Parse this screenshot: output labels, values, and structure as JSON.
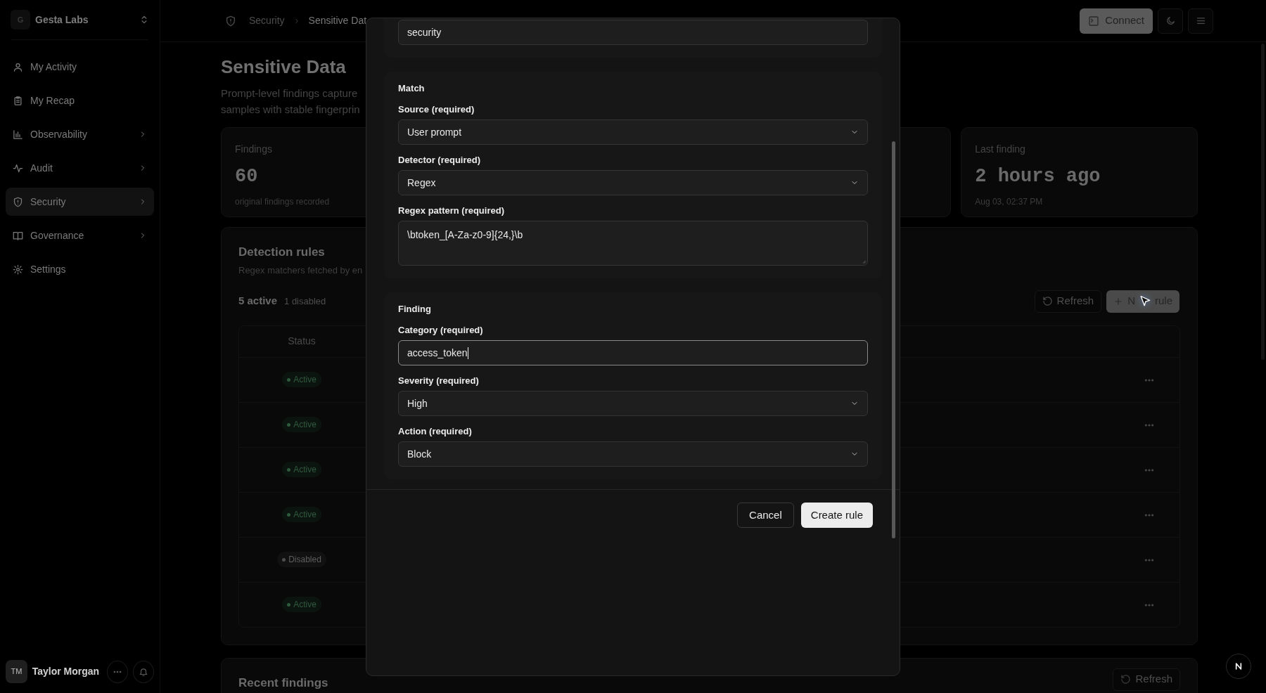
{
  "sidebar": {
    "workspace": {
      "initial": "G",
      "name": "Gesta Labs"
    },
    "items": [
      {
        "label": "My Activity",
        "has_children": false,
        "selected": false
      },
      {
        "label": "My Recap",
        "has_children": false,
        "selected": false
      },
      {
        "label": "Observability",
        "has_children": true,
        "selected": false
      },
      {
        "label": "Audit",
        "has_children": true,
        "selected": false
      },
      {
        "label": "Security",
        "has_children": true,
        "selected": true
      },
      {
        "label": "Governance",
        "has_children": true,
        "selected": false
      },
      {
        "label": "Settings",
        "has_children": false,
        "selected": false
      }
    ],
    "user": {
      "initials": "TM",
      "name": "Taylor Morgan"
    }
  },
  "header": {
    "breadcrumb": [
      "Security",
      "Sensitive Dat"
    ],
    "connect_label": "Connect"
  },
  "page": {
    "title": "Sensitive Data",
    "description_lines": [
      "Prompt-level findings capture",
      "samples with stable fingerprin"
    ],
    "stats": [
      {
        "label": "Findings",
        "value": "60",
        "note": "original findings recorded"
      },
      {
        "label": "Last finding",
        "value": "2 hours ago",
        "note": "Aug 03, 02:37 PM"
      }
    ],
    "rules": {
      "title": "Detection rules",
      "subtitle": "Regex matchers fetched by en",
      "active_count": "5 active",
      "disabled_count": "1 disabled",
      "refresh": "Refresh",
      "new_rule": [
        "N",
        "rule"
      ],
      "columns": [
        "Status"
      ],
      "rows": [
        {
          "status": "Active",
          "active": true
        },
        {
          "status": "Active",
          "active": true
        },
        {
          "status": "Active",
          "active": true
        },
        {
          "status": "Active",
          "active": true
        },
        {
          "status": "Disabled",
          "active": false
        },
        {
          "status": "Active",
          "active": true
        }
      ]
    },
    "recent": {
      "title": "Recent findings",
      "refresh": "Refresh"
    }
  },
  "modal": {
    "top_value": "security",
    "sections": [
      {
        "title": "Match",
        "fields": [
          {
            "label": "Source (required)",
            "kind": "select",
            "value": "User prompt",
            "focused": false
          },
          {
            "label": "Detector (required)",
            "kind": "select",
            "value": "Regex",
            "focused": false
          },
          {
            "label": "Regex pattern (required)",
            "kind": "textarea",
            "value": "\\btoken_[A-Za-z0-9]{24,}\\b",
            "focused": false
          }
        ]
      },
      {
        "title": "Finding",
        "fields": [
          {
            "label": "Category (required)",
            "kind": "text",
            "value": "access_token",
            "focused": true
          },
          {
            "label": "Severity (required)",
            "kind": "select",
            "value": "High",
            "focused": false
          },
          {
            "label": "Action (required)",
            "kind": "select",
            "value": "Block",
            "focused": false
          }
        ]
      }
    ],
    "buttons": [
      {
        "label": "Cancel",
        "primary": false
      },
      {
        "label": "Create rule",
        "primary": true
      }
    ]
  }
}
